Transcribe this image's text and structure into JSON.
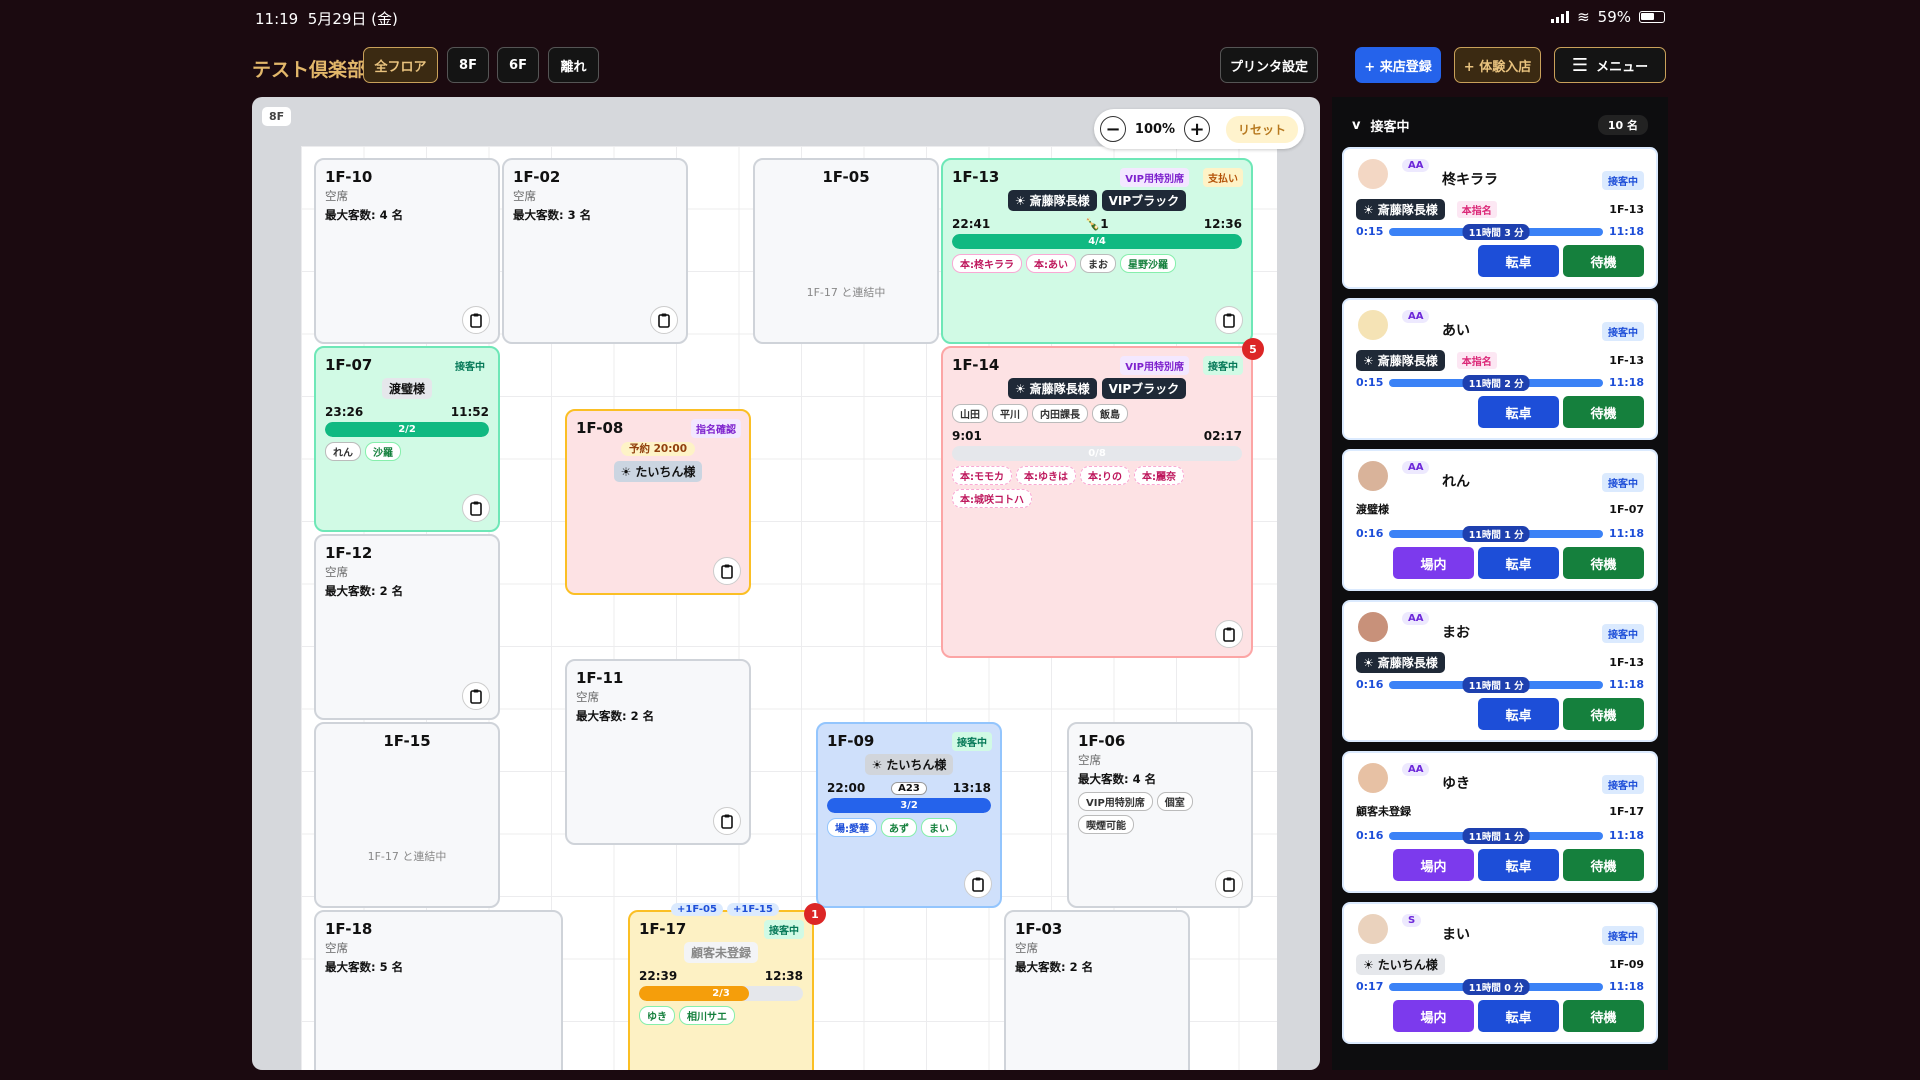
{
  "status_bar": {
    "time": "11:19",
    "date": "5月29日 (金)",
    "battery": "59%"
  },
  "header": {
    "brand": "テスト倶楽部",
    "floors": [
      "全フロア",
      "8F",
      "6F",
      "離れ"
    ],
    "printer": "プリンタ設定",
    "register": "+ 来店登録",
    "trial": "+ 体験入店",
    "menu": "メニュー"
  },
  "floor": {
    "tag": "8F",
    "zoom": "100%",
    "reset": "リセット",
    "tables": {
      "t10": {
        "name": "1F-10",
        "status": "空席",
        "cap": "最大客数: 4 名"
      },
      "t02": {
        "name": "1F-02",
        "status": "空席",
        "cap": "最大客数: 3 名"
      },
      "t05": {
        "name": "1F-05",
        "linked": "1F-17 と連結中"
      },
      "t13": {
        "name": "1F-13",
        "badge1": "VIP用特別席",
        "badge2": "支払い",
        "guest": "斎藤隊長様",
        "vip": "VIPブラック",
        "start": "22:41",
        "bottles": "1",
        "end": "12:36",
        "progress": "4/4",
        "chips": [
          "本:柊キララ",
          "本:あい",
          "まお",
          "星野沙羅"
        ]
      },
      "t07": {
        "name": "1F-07",
        "badge": "接客中",
        "guest": "渡璧様",
        "start": "23:26",
        "end": "11:52",
        "progress": "2/2",
        "chips": [
          "れん",
          "沙羅"
        ]
      },
      "t08": {
        "name": "1F-08",
        "badge": "指名確認",
        "reserve": "予約 20:00",
        "guest": "たいちん様"
      },
      "t14": {
        "name": "1F-14",
        "badge1": "VIP用特別席",
        "badge2": "接客中",
        "count": "5",
        "guest": "斎藤隊長様",
        "vip": "VIPブラック",
        "names": [
          "山田",
          "平川",
          "内田課長",
          "飯島"
        ],
        "start": "9:01",
        "end": "02:17",
        "progress": "0/8",
        "chips": [
          "本:モモカ",
          "本:ゆきは",
          "本:りの",
          "本:麗奈",
          "本:城咲コトハ"
        ]
      },
      "t12": {
        "name": "1F-12",
        "status": "空席",
        "cap": "最大客数: 2 名"
      },
      "t11": {
        "name": "1F-11",
        "status": "空席",
        "cap": "最大客数: 2 名"
      },
      "t15": {
        "name": "1F-15",
        "linked": "1F-17 と連結中"
      },
      "t09": {
        "name": "1F-09",
        "badge": "接客中",
        "guest": "たいちん様",
        "start": "22:00",
        "code": "A23",
        "end": "13:18",
        "progress": "3/2",
        "chips": [
          "場:愛華",
          "あず",
          "まい"
        ]
      },
      "t06": {
        "name": "1F-06",
        "status": "空席",
        "cap": "最大客数: 4 名",
        "tags": [
          "VIP用特別席",
          "個室",
          "喫煙可能"
        ]
      },
      "t18": {
        "name": "1F-18",
        "status": "空席",
        "cap": "最大客数: 5 名"
      },
      "t17": {
        "name": "1F-17",
        "link1": "+1F-05",
        "link2": "+1F-15",
        "count": "1",
        "badge": "接客中",
        "guest": "顧客未登録",
        "start": "22:39",
        "end": "12:38",
        "progress": "2/3",
        "chips": [
          "ゆき",
          "相川サエ"
        ]
      },
      "t03": {
        "name": "1F-03",
        "status": "空席",
        "cap": "最大客数: 2 名"
      }
    }
  },
  "side": {
    "title": "接客中",
    "count": "10 名",
    "casts": [
      {
        "rank": "AA",
        "name": "柊キララ",
        "state": "接客中",
        "guest": "斎藤隊長様",
        "hon": "本指名",
        "table": "1F-13",
        "t1": "0:15",
        "dur": "11時間 3 分",
        "t2": "11:18",
        "a1": "",
        "a2": "転卓",
        "a3": "待機"
      },
      {
        "rank": "AA",
        "name": "あい",
        "state": "接客中",
        "guest": "斎藤隊長様",
        "hon": "本指名",
        "table": "1F-13",
        "t1": "0:15",
        "dur": "11時間 2 分",
        "t2": "11:18",
        "a1": "",
        "a2": "転卓",
        "a3": "待機"
      },
      {
        "rank": "AA",
        "name": "れん",
        "state": "接客中",
        "guest": "渡璧様",
        "hon": "",
        "table": "1F-07",
        "t1": "0:16",
        "dur": "11時間 1 分",
        "t2": "11:18",
        "a1": "場内",
        "a2": "転卓",
        "a3": "待機"
      },
      {
        "rank": "AA",
        "name": "まお",
        "state": "接客中",
        "guest": "斎藤隊長様",
        "hon": "",
        "table": "1F-13",
        "t1": "0:16",
        "dur": "11時間 1 分",
        "t2": "11:18",
        "a1": "",
        "a2": "転卓",
        "a3": "待機"
      },
      {
        "rank": "AA",
        "name": "ゆき",
        "state": "接客中",
        "guest": "顧客未登録",
        "hon": "",
        "table": "1F-17",
        "t1": "0:16",
        "dur": "11時間 1 分",
        "t2": "11:18",
        "a1": "場内",
        "a2": "転卓",
        "a3": "待機"
      },
      {
        "rank": "S",
        "name": "まい",
        "state": "接客中",
        "guest": "たいちん様",
        "hon": "",
        "table": "1F-09",
        "t1": "0:17",
        "dur": "11時間 0 分",
        "t2": "11:18",
        "a1": "場内",
        "a2": "転卓",
        "a3": "待機"
      }
    ]
  }
}
